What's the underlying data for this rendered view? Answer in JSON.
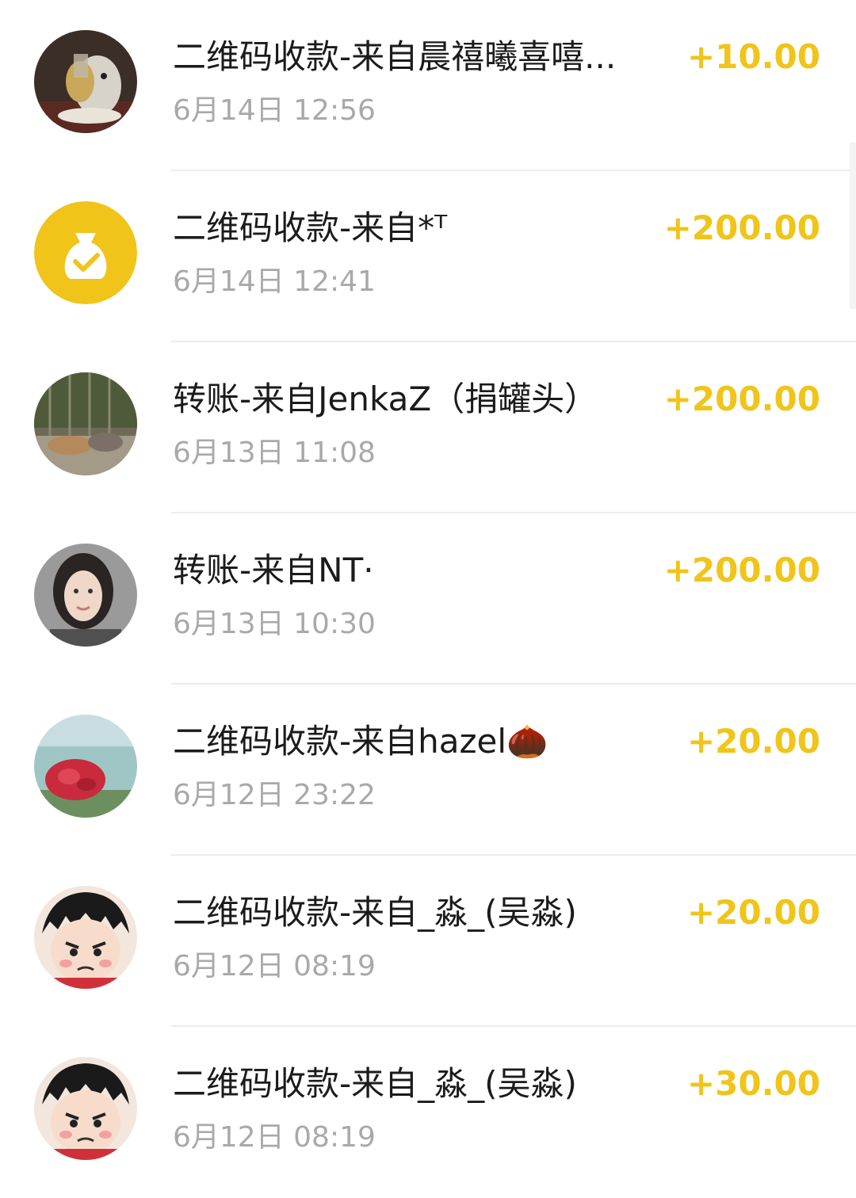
{
  "colors": {
    "amount": "#f0c419",
    "title": "#1b1b1b",
    "time": "#a9a9a9",
    "divider": "#ececec",
    "badge": "#f0c419"
  },
  "transactions": [
    {
      "title": "二维码收款-来自晨禧曦喜嘻...",
      "time": "6月14日 12:56",
      "amount": "+10.00",
      "avatar": "cat-photo-avatar"
    },
    {
      "title": "二维码收款-来自*ᵀ",
      "time": "6月14日 12:41",
      "amount": "+200.00",
      "avatar": "money-bag-icon"
    },
    {
      "title": "转账-来自JenkaZ（捐罐头）",
      "time": "6月13日 11:08",
      "amount": "+200.00",
      "avatar": "cats-outdoor-photo-avatar"
    },
    {
      "title": "转账-来自NT·",
      "time": "6月13日 10:30",
      "amount": "+200.00",
      "avatar": "woman-photo-avatar"
    },
    {
      "title": "二维码收款-来自hazel🌰",
      "time": "6月12日 23:22",
      "amount": "+20.00",
      "avatar": "red-flowers-photo-avatar"
    },
    {
      "title": "二维码收款-来自_淼_(吴淼)",
      "time": "6月12日 08:19",
      "amount": "+20.00",
      "avatar": "cartoon-boy-avatar"
    },
    {
      "title": "二维码收款-来自_淼_(吴淼)",
      "time": "6月12日 08:19",
      "amount": "+30.00",
      "avatar": "cartoon-boy-avatar"
    }
  ]
}
